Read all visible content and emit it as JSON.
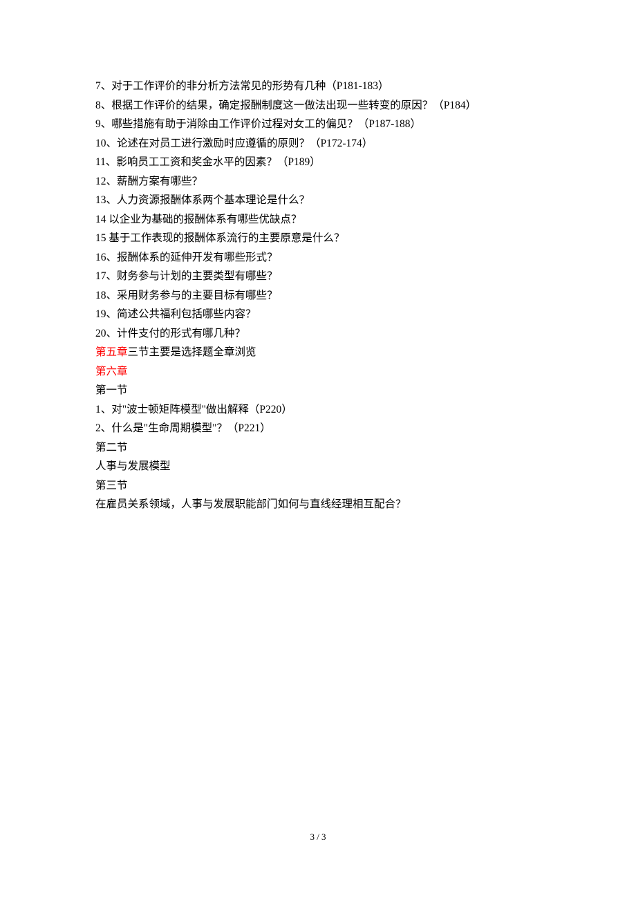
{
  "lines": [
    {
      "text": "7、对于工作评价的非分析方法常见的形势有几种（P181-183）"
    },
    {
      "text": "8、根据工作评价的结果，确定报酬制度这一做法出现一些转变的原因？（P184）"
    },
    {
      "text": "9、哪些措施有助于消除由工作评价过程对女工的偏见？（P187-188）"
    },
    {
      "text": "10、论述在对员工进行激励时应遵循的原则？（P172-174）"
    },
    {
      "text": "11、影响员工工资和奖金水平的因素？（P189）"
    },
    {
      "text": "12、薪酬方案有哪些？"
    },
    {
      "text": "13、人力资源报酬体系两个基本理论是什么？"
    },
    {
      "text": "14 以企业为基础的报酬体系有哪些优缺点？"
    },
    {
      "text": "15 基于工作表现的报酬体系流行的主要原意是什么？"
    },
    {
      "text": "16、报酬体系的延伸开发有哪些形式？"
    },
    {
      "text": "17、财务参与计划的主要类型有哪些？"
    },
    {
      "text": "18、采用财务参与的主要目标有哪些？"
    },
    {
      "text": "19、简述公共福利包括哪些内容？"
    },
    {
      "text": "20、计件支付的形式有哪几种？"
    },
    {
      "redPart": "第五章",
      "text": "三节主要是选择题全章浏览"
    },
    {
      "redPart": "第六章",
      "text": ""
    },
    {
      "text": "第一节"
    },
    {
      "text": "1、对\"波士顿矩阵模型\"做出解释（P220）"
    },
    {
      "text": "2、什么是\"生命周期模型\"？（P221）"
    },
    {
      "text": "第二节"
    },
    {
      "text": "人事与发展模型"
    },
    {
      "text": "第三节"
    },
    {
      "text": "在雇员关系领域，人事与发展职能部门如何与直线经理相互配合？"
    }
  ],
  "footer": "3 / 3"
}
